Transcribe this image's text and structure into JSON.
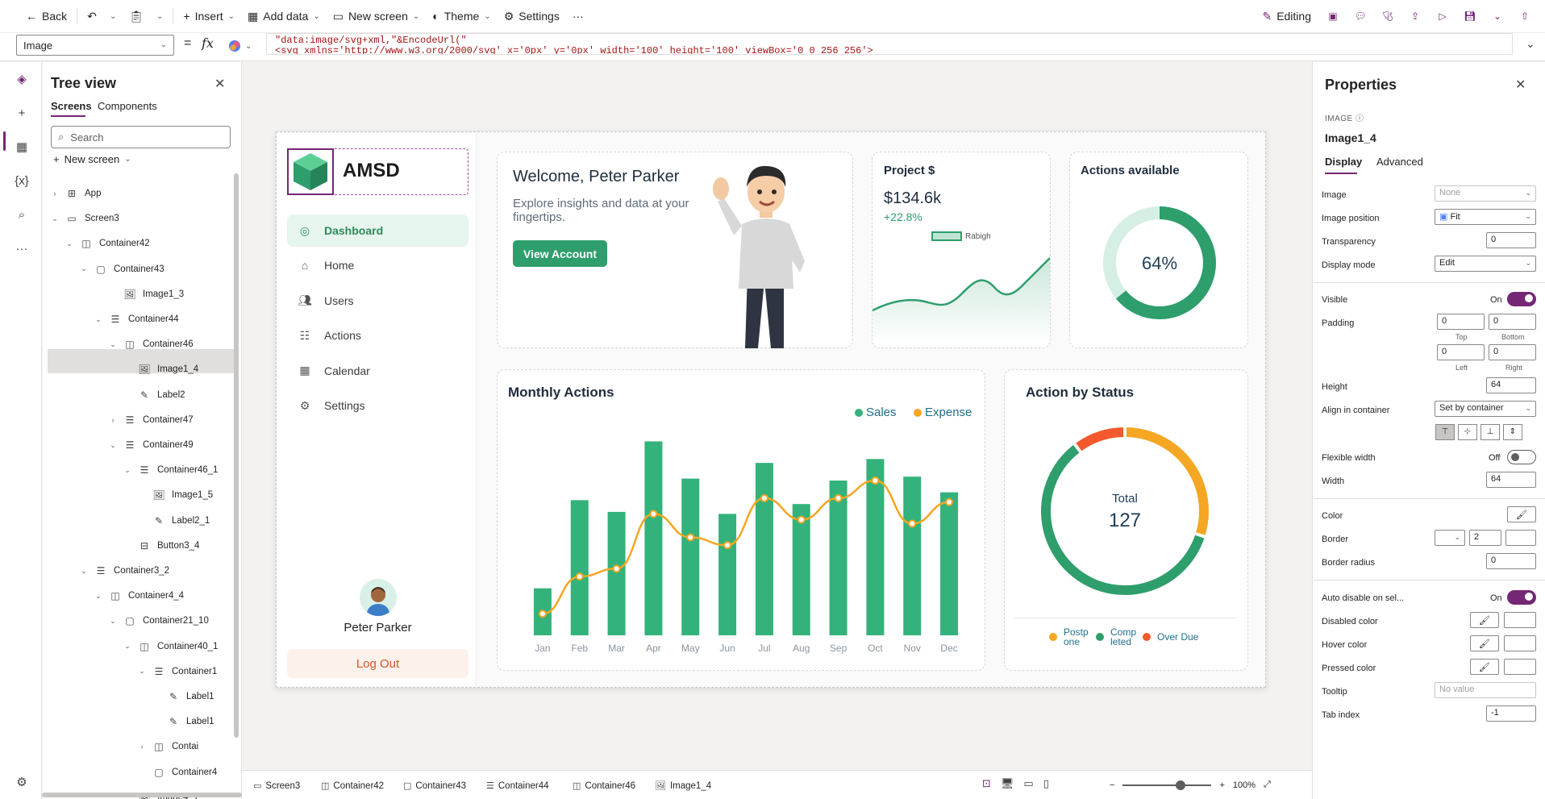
{
  "topbar": {
    "back": "Back",
    "insert": "Insert",
    "add_data": "Add data",
    "new_screen": "New screen",
    "theme": "Theme",
    "settings": "Settings",
    "more": "···",
    "editing": "Editing"
  },
  "formula": {
    "property": "Image",
    "equals": "=",
    "fx": "fx",
    "line1": "\"data:image/svg+xml,\"&EncodeUrl(\"",
    "line2": "<svg xmlns='http://www.w3.org/2000/svg' x='0px' y='0px' width='100' height='100' viewBox='0 0 256 256'>"
  },
  "tree": {
    "title": "Tree view",
    "tabs": [
      "Screens",
      "Components"
    ],
    "search_placeholder": "Search",
    "new_screen": "New screen",
    "items": [
      {
        "label": "App",
        "icon": "app-icon",
        "twisty": "right"
      },
      {
        "label": "Screen3",
        "icon": "screen-icon",
        "twisty": "down"
      },
      {
        "label": "Container42",
        "icon": "horizontal-container-icon",
        "twisty": "down"
      },
      {
        "label": "Container43",
        "icon": "container-icon",
        "twisty": "down"
      },
      {
        "label": "Image1_3",
        "icon": "image-icon",
        "twisty": ""
      },
      {
        "label": "Container44",
        "icon": "vertical-container-icon",
        "twisty": "down"
      },
      {
        "label": "Container46",
        "icon": "horizontal-container-icon",
        "twisty": "down"
      },
      {
        "label": "Image1_4",
        "icon": "image-icon",
        "twisty": ""
      },
      {
        "label": "Label2",
        "icon": "label-icon",
        "twisty": ""
      },
      {
        "label": "Container47",
        "icon": "vertical-container-icon",
        "twisty": "right"
      },
      {
        "label": "Container49",
        "icon": "vertical-container-icon",
        "twisty": "down"
      },
      {
        "label": "Container46_1",
        "icon": "vertical-container-icon",
        "twisty": "down"
      },
      {
        "label": "Image1_5",
        "icon": "image-icon",
        "twisty": ""
      },
      {
        "label": "Label2_1",
        "icon": "label-icon",
        "twisty": ""
      },
      {
        "label": "Button3_4",
        "icon": "button-icon",
        "twisty": ""
      },
      {
        "label": "Container3_2",
        "icon": "vertical-container-icon",
        "twisty": "down"
      },
      {
        "label": "Container4_4",
        "icon": "horizontal-container-icon",
        "twisty": "down"
      },
      {
        "label": "Container21_10",
        "icon": "container-icon",
        "twisty": "down"
      },
      {
        "label": "Container40_1",
        "icon": "horizontal-container-icon",
        "twisty": "down"
      },
      {
        "label": "Container1",
        "icon": "vertical-container-icon",
        "twisty": "down"
      },
      {
        "label": "Label1",
        "icon": "label-icon",
        "twisty": ""
      },
      {
        "label": "Label1",
        "icon": "label-icon",
        "twisty": ""
      },
      {
        "label": "Contai",
        "icon": "horizontal-container-icon",
        "twisty": "right"
      },
      {
        "label": "Container4",
        "icon": "container-icon",
        "twisty": ""
      },
      {
        "label": "Image4_1",
        "icon": "image-icon",
        "twisty": ""
      }
    ]
  },
  "app": {
    "brand": "AMSD",
    "nav": [
      {
        "label": "Dashboard",
        "icon": "dashboard-icon",
        "active": true
      },
      {
        "label": "Home",
        "icon": "home-icon",
        "active": false
      },
      {
        "label": "Users",
        "icon": "users-icon",
        "active": false
      },
      {
        "label": "Actions",
        "icon": "actions-icon",
        "active": false
      },
      {
        "label": "Calendar",
        "icon": "calendar-icon",
        "active": false
      },
      {
        "label": "Settings",
        "icon": "settings-icon",
        "active": false
      }
    ],
    "user_name": "Peter Parker",
    "logout": "Log Out",
    "welcome_title": "Welcome, Peter Parker",
    "welcome_sub": "Explore insights and data at your fingertips.",
    "view_account": "View Account",
    "project_title": "Project $",
    "project_value": "$134.6k",
    "project_change": "+22.8%",
    "project_legend": "Rabigh",
    "actions_title": "Actions available",
    "actions_pct": "64%",
    "actions_fraction": 0.64,
    "monthly_title": "Monthly Actions",
    "status_title": "Action by Status",
    "total_label": "Total",
    "total_value": "127",
    "colors": {
      "green": "#2e9e6c",
      "orange": "#f5a623",
      "red": "#f4582d"
    }
  },
  "chart_data": [
    {
      "type": "bar",
      "title": "Monthly Actions",
      "categories": [
        "Jan",
        "Feb",
        "Mar",
        "Apr",
        "May",
        "Jun",
        "Jul",
        "Aug",
        "Sep",
        "Oct",
        "Nov",
        "Dec"
      ],
      "ylim": [
        0,
        100
      ],
      "series": [
        {
          "name": "Sales",
          "type": "bar",
          "color": "#34b27b",
          "values": [
            24,
            69,
            63,
            99,
            80,
            62,
            88,
            67,
            79,
            90,
            81,
            73
          ]
        },
        {
          "name": "Expense",
          "type": "line",
          "color": "#f5a623",
          "values": [
            11,
            30,
            34,
            62,
            50,
            46,
            70,
            59,
            70,
            79,
            57,
            68
          ]
        }
      ],
      "legend": "top-right"
    },
    {
      "type": "pie",
      "title": "Action by Status",
      "labels": [
        "Postp one",
        "Comp leted",
        "Over Due"
      ],
      "values": [
        38,
        76,
        13
      ],
      "colors": [
        "#f5a623",
        "#2e9e6c",
        "#f4582d"
      ],
      "center_label": "Total",
      "center_value": "127",
      "legend": "bottom"
    }
  ],
  "props": {
    "title": "Properties",
    "type": "IMAGE",
    "name": "Image1_4",
    "tabs": [
      "Display",
      "Advanced"
    ],
    "image_label": "Image",
    "image_value": "None",
    "image_position_label": "Image position",
    "image_position_value": "Fit",
    "transparency_label": "Transparency",
    "transparency_value": "0",
    "display_mode_label": "Display mode",
    "display_mode_value": "Edit",
    "visible_label": "Visible",
    "visible_state": "On",
    "padding_label": "Padding",
    "pad_top": "0",
    "pad_bottom": "0",
    "pad_left": "0",
    "pad_right": "0",
    "top_l": "Top",
    "bottom_l": "Bottom",
    "left_l": "Left",
    "right_l": "Right",
    "height_label": "Height",
    "height_value": "64",
    "align_label": "Align in container",
    "align_value": "Set by container",
    "flex_label": "Flexible width",
    "flex_state": "Off",
    "width_label": "Width",
    "width_value": "64",
    "color_label": "Color",
    "border_label": "Border",
    "border_value": "2",
    "radius_label": "Border radius",
    "radius_value": "0",
    "auto_disable_label": "Auto disable on sel...",
    "auto_disable_state": "On",
    "disabled_color_label": "Disabled color",
    "hover_color_label": "Hover color",
    "pressed_color_label": "Pressed color",
    "tooltip_label": "Tooltip",
    "tooltip_placeholder": "No value",
    "tab_index_label": "Tab index",
    "tab_index_value": "-1"
  },
  "status": {
    "crumbs": [
      "Screen3",
      "Container42",
      "Container43",
      "Container44",
      "Container46",
      "Image1_4"
    ],
    "zoom": "100%"
  }
}
